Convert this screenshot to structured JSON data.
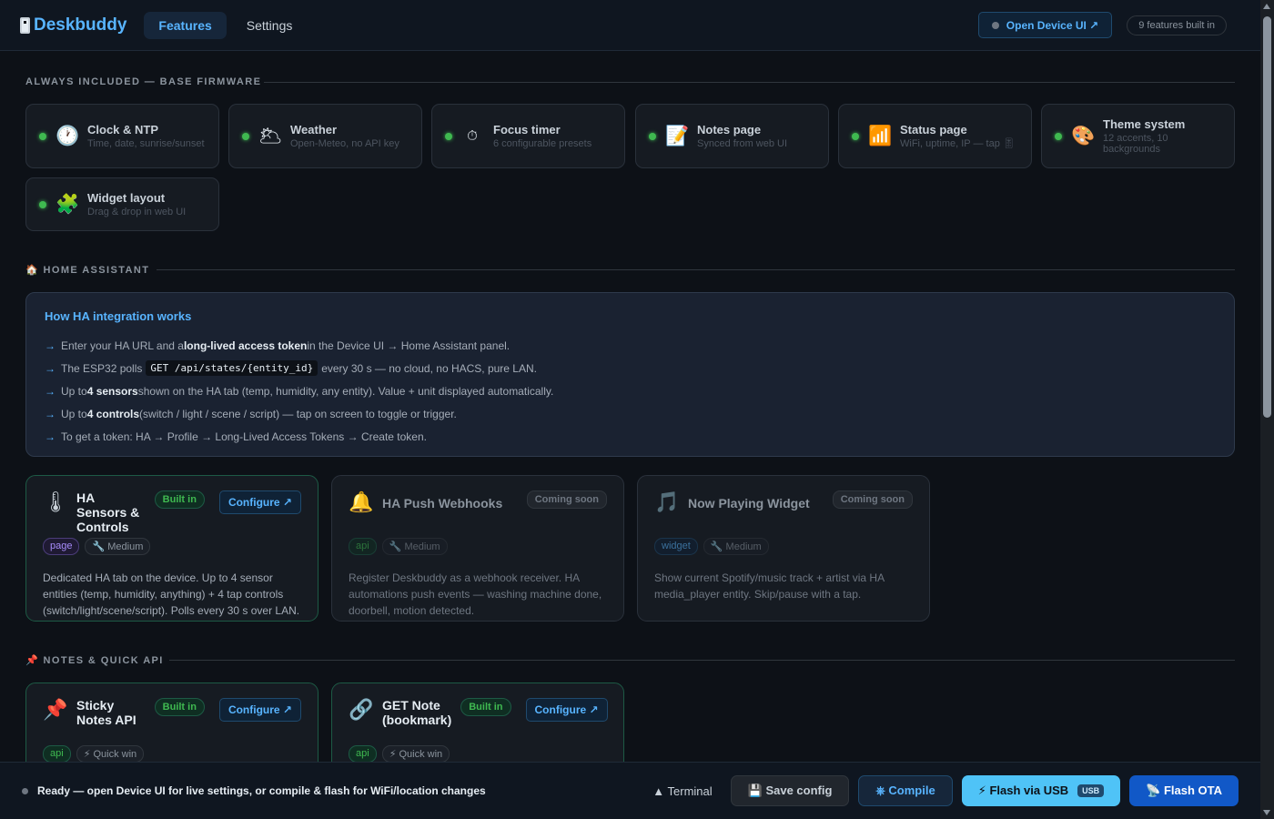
{
  "header": {
    "app_name": "Deskbuddy",
    "tabs": [
      "Features",
      "Settings"
    ],
    "open_device_label": "Open Device UI ↗",
    "features_count": "9 features built in"
  },
  "base_section": {
    "label": "ALWAYS INCLUDED — BASE FIRMWARE",
    "cards": [
      {
        "icon": "🕐",
        "icon_name": "clock-icon",
        "title": "Clock & NTP",
        "subtitle": "Time, date, sunrise/sunset"
      },
      {
        "icon": "🌥",
        "icon_name": "weather-icon",
        "title": "Weather",
        "subtitle": "Open-Meteo, no API key"
      },
      {
        "icon": "⏱",
        "icon_name": "timer-icon",
        "title": "Focus timer",
        "subtitle": "6 configurable presets"
      },
      {
        "icon": "📝",
        "icon_name": "notes-icon",
        "title": "Notes page",
        "subtitle": "Synced from web UI"
      },
      {
        "icon": "📶",
        "icon_name": "signal-icon",
        "title": "Status page",
        "subtitle": "WiFi, uptime, IP — tap 🎚"
      },
      {
        "icon": "🎨",
        "icon_name": "palette-icon",
        "title": "Theme system",
        "subtitle": "12 accents, 10 backgrounds"
      },
      {
        "icon": "🧩",
        "icon_name": "puzzle-icon",
        "title": "Widget layout",
        "subtitle": "Drag & drop in web UI"
      }
    ]
  },
  "ha_section": {
    "label": "🏠 HOME ASSISTANT",
    "info": {
      "title": "How HA integration works",
      "arrow": "→",
      "line1_a": "Enter your HA URL and a ",
      "line1_b": "long-lived access token",
      "line1_c": " in the Device UI → Home Assistant panel.",
      "line2_a": "The ESP32 polls",
      "line2_code": "GET /api/states/{entity_id}",
      "line2_b": "every 30 s — no cloud, no HACS, pure LAN.",
      "line3_a": "Up to ",
      "line3_b": "4 sensors",
      "line3_c": " shown on the HA tab (temp, humidity, any entity). Value + unit displayed automatically.",
      "line4_a": "Up to ",
      "line4_b": "4 controls",
      "line4_c": " (switch / light / scene / script) — tap on screen to toggle or trigger.",
      "line5": "To get a token: HA → Profile → Long-Lived Access Tokens → Create token."
    },
    "cards": [
      {
        "icon": "🌡",
        "title": "HA Sensors & Controls",
        "status": "Built in",
        "configure": "Configure ↗",
        "tag": "page",
        "effort": "🔧 Medium",
        "desc": "Dedicated HA tab on the device. Up to 4 sensor entities (temp, humidity, anything) + 4 tap controls (switch/light/scene/script). Polls every 30 s over LAN."
      },
      {
        "icon": "🔔",
        "title": "HA Push Webhooks",
        "status": "Coming soon",
        "tag": "api",
        "effort": "🔧 Medium",
        "desc": "Register Deskbuddy as a webhook receiver. HA automations push events — washing machine done, doorbell, motion detected."
      },
      {
        "icon": "🎵",
        "title": "Now Playing Widget",
        "status": "Coming soon",
        "tag": "widget",
        "effort": "🔧 Medium",
        "desc": "Show current Spotify/music track + artist via HA media_player entity. Skip/pause with a tap."
      }
    ]
  },
  "notes_section": {
    "label": "📌 NOTES & QUICK API",
    "cards": [
      {
        "icon": "📌",
        "title": "Sticky Notes API",
        "status": "Built in",
        "configure": "Configure ↗",
        "tag": "api",
        "effort": "⚡ Quick win"
      },
      {
        "icon": "🔗",
        "title": "GET Note (bookmark)",
        "status": "Built in",
        "configure": "Configure ↗",
        "tag": "api",
        "effort": "⚡ Quick win"
      }
    ]
  },
  "bottom_bar": {
    "status": "Ready — open Device UI for live settings, or compile & flash for WiFi/location changes",
    "terminal": "▲ Terminal",
    "save": "💾 Save config",
    "compile": "⎈ Compile",
    "flash_usb": "⚡ Flash via USB",
    "usb_pill": "USB",
    "flash_ota": "📡 Flash OTA"
  },
  "colors": {
    "background": "#0d1117",
    "accent": "#58b4ff",
    "built_green": "#3fb950",
    "flash_usb": "#4fc3f7",
    "flash_ota": "#1158c7"
  }
}
